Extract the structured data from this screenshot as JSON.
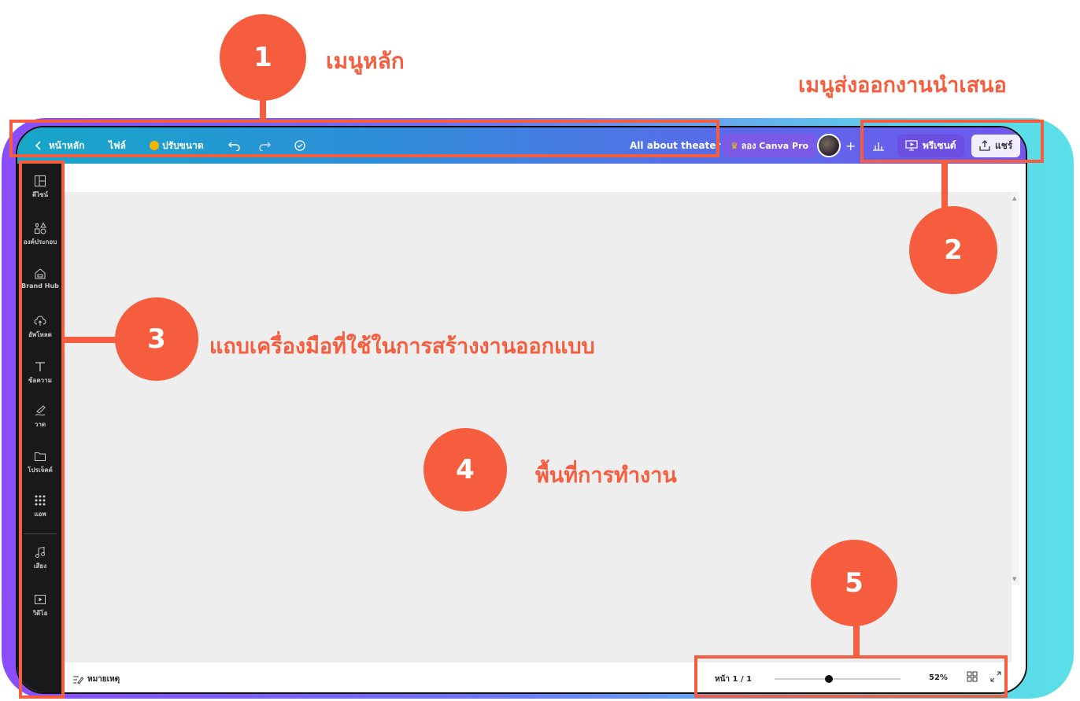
{
  "topbar": {
    "home": "หน้าหลัก",
    "file": "ไฟล์",
    "resize": "ปรับขนาด",
    "title": "All about theater",
    "pro": "ลอง Canva Pro",
    "plus": "+",
    "present": "พรีเซนต์",
    "share": "แชร์"
  },
  "sidebar": {
    "items": [
      {
        "label": "ดีไซน์",
        "icon": "layout-icon"
      },
      {
        "label": "องค์ประกอบ",
        "icon": "shapes-icon"
      },
      {
        "label": "Brand Hub",
        "icon": "brand-icon"
      },
      {
        "label": "อัพโหลด",
        "icon": "upload-cloud-icon"
      },
      {
        "label": "ข้อความ",
        "icon": "text-icon"
      },
      {
        "label": "วาด",
        "icon": "draw-icon"
      },
      {
        "label": "โปรเจ็คต์",
        "icon": "folder-icon"
      },
      {
        "label": "แอพ",
        "icon": "apps-grid-icon"
      },
      {
        "label": "เสียง",
        "icon": "music-icon"
      },
      {
        "label": "วิดีโอ",
        "icon": "video-icon"
      }
    ]
  },
  "bottombar": {
    "notes": "หมายเหตุ",
    "page": "หน้า 1 / 1",
    "zoom": "52%",
    "zoom_level": 0.43
  },
  "annotations": {
    "c1": {
      "num": "1",
      "label": "เมนูหลัก"
    },
    "c2": {
      "num": "2",
      "label": "เมนูส่งออกงานนำเสนอ"
    },
    "c3": {
      "num": "3",
      "label": "แถบเครื่องมือที่ใช้ในการสร้างงานออกแบบ"
    },
    "c4": {
      "num": "4",
      "label": "พื้นที่การทำงาน"
    },
    "c5": {
      "num": "5"
    }
  },
  "colors": {
    "accent": "#f55d3e",
    "sidebar": "#18191b",
    "canvas": "#eeeeee"
  }
}
